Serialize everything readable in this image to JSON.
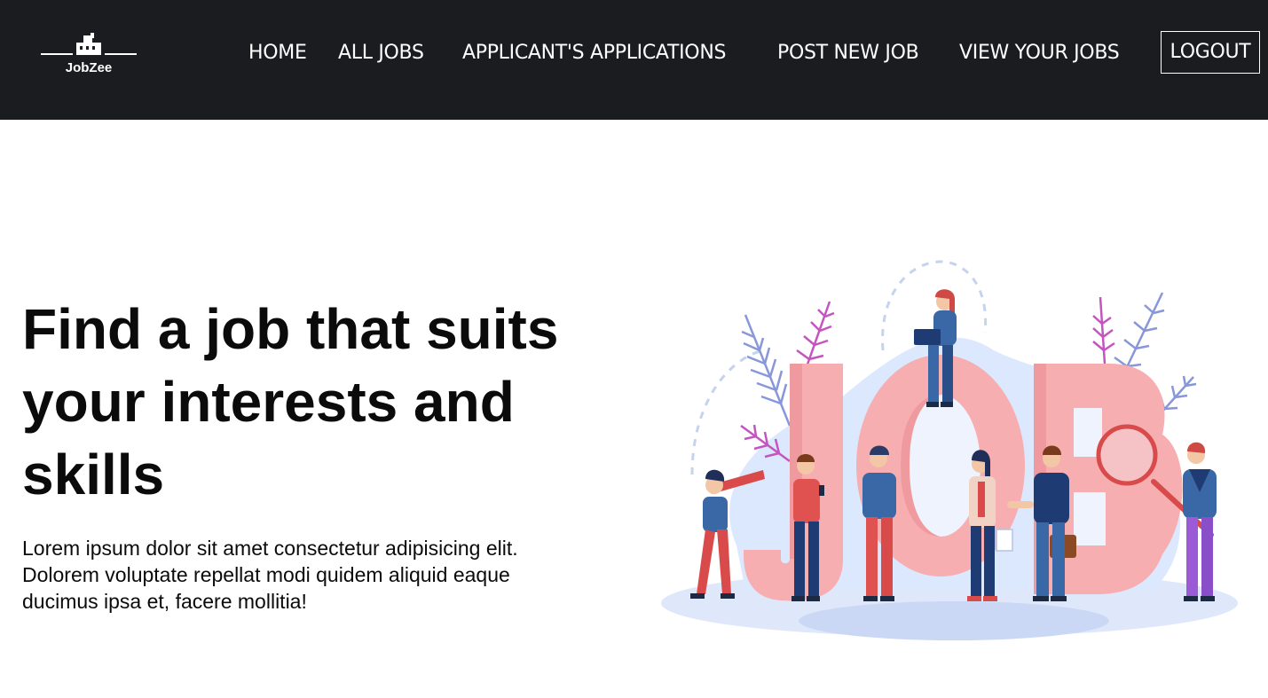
{
  "brand": {
    "name": "JobZee"
  },
  "nav": {
    "items": [
      {
        "label": "HOME"
      },
      {
        "label": "ALL JOBS"
      },
      {
        "label": "APPLICANT'S APPLICATIONS"
      },
      {
        "label": "POST NEW JOB"
      },
      {
        "label": "VIEW YOUR JOBS"
      }
    ],
    "logout_label": "LOGOUT"
  },
  "hero": {
    "title": "Find a job that suits your interests and skills",
    "description": "Lorem ipsum dolor sit amet consectetur adipisicing elit. Dolorem voluptate repellat modi quidem aliquid eaque ducimus ipsa et, facere mollitia!",
    "illustration_letters": "JOB"
  },
  "colors": {
    "navbar_bg": "#1b1c1f",
    "letters_pink": "#f6aeb1",
    "blob_blue": "#dbe8fd",
    "ground_blue": "#cbd8f5"
  }
}
